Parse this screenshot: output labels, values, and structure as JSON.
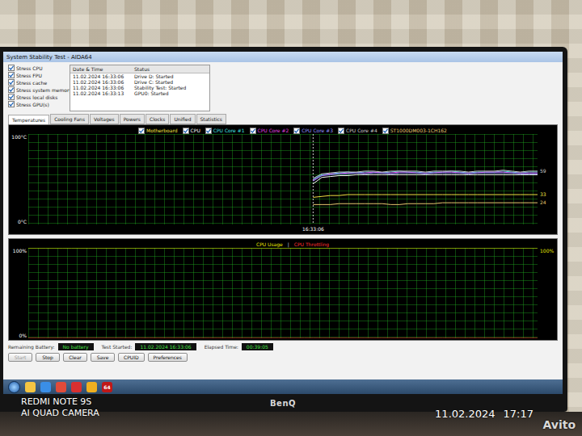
{
  "photo": {
    "camera_model": "REDMI NOTE 9S",
    "camera_label": "AI QUAD CAMERA",
    "date": "11.02.2024",
    "time": "17:17",
    "watermark": "Avito"
  },
  "monitor": {
    "brand": "BenQ"
  },
  "window": {
    "title": "System Stability Test - AIDA64"
  },
  "stress_options": [
    {
      "label": "Stress CPU",
      "checked": true
    },
    {
      "label": "Stress FPU",
      "checked": true
    },
    {
      "label": "Stress cache",
      "checked": true
    },
    {
      "label": "Stress system memory",
      "checked": true
    },
    {
      "label": "Stress local disks",
      "checked": true
    },
    {
      "label": "Stress GPU(s)",
      "checked": true
    }
  ],
  "log": {
    "columns": [
      "Date & Time",
      "Status"
    ],
    "rows": [
      [
        "11.02.2024 16:33:06",
        "Drive D: Started"
      ],
      [
        "11.02.2024 16:33:06",
        "Drive C: Started"
      ],
      [
        "11.02.2024 16:33:06",
        "Stability Test: Started"
      ],
      [
        "11.02.2024 16:33:13",
        "GPU0: Started"
      ]
    ]
  },
  "tabs": [
    {
      "label": "Temperatures",
      "selected": true
    },
    {
      "label": "Cooling Fans",
      "selected": false
    },
    {
      "label": "Voltages",
      "selected": false
    },
    {
      "label": "Powers",
      "selected": false
    },
    {
      "label": "Clocks",
      "selected": false
    },
    {
      "label": "Unified",
      "selected": false
    },
    {
      "label": "Statistics",
      "selected": false
    }
  ],
  "temperature_chart": {
    "axis_top": "100°C",
    "axis_bottom": "0°C",
    "time_mark": "16:33:06",
    "series": [
      {
        "label": "Motherboard",
        "checked": true,
        "color": "#f0e040",
        "reading": "33",
        "values": [
          30,
          31,
          32,
          32,
          33,
          33,
          33,
          33,
          33,
          33,
          33,
          33,
          33,
          33,
          33,
          33,
          33,
          33,
          33,
          33,
          33,
          33,
          33,
          33,
          33,
          33,
          33
        ]
      },
      {
        "label": "CPU",
        "checked": true,
        "color": "#ffffff",
        "values": [
          45,
          52,
          53,
          54,
          54,
          55,
          55,
          55,
          55,
          55,
          55,
          55,
          55,
          55,
          55,
          55,
          55,
          55,
          55,
          55,
          55,
          55,
          55,
          55,
          55,
          55,
          55
        ]
      },
      {
        "label": "CPU Core #1",
        "checked": true,
        "color": "#40e0e0",
        "values": [
          50,
          55,
          56,
          57,
          58,
          57,
          58,
          58,
          57,
          58,
          59,
          58,
          58,
          57,
          58,
          58,
          59,
          58,
          57,
          58,
          58,
          58,
          59,
          58,
          57,
          58,
          58
        ]
      },
      {
        "label": "CPU Core #2",
        "checked": true,
        "color": "#e040e0",
        "values": [
          49,
          54,
          56,
          56,
          57,
          57,
          57,
          58,
          57,
          57,
          58,
          58,
          57,
          57,
          57,
          58,
          58,
          57,
          57,
          57,
          58,
          58,
          58,
          57,
          57,
          57,
          57
        ]
      },
      {
        "label": "CPU Core #3",
        "checked": true,
        "color": "#9090ff",
        "values": [
          48,
          54,
          55,
          56,
          56,
          57,
          56,
          57,
          57,
          56,
          57,
          57,
          57,
          56,
          57,
          57,
          57,
          57,
          56,
          57,
          57,
          57,
          57,
          57,
          56,
          56,
          56
        ]
      },
      {
        "label": "CPU Core #4",
        "checked": true,
        "color": "#c8c8c8",
        "reading": "59",
        "values": [
          51,
          56,
          57,
          58,
          58,
          58,
          59,
          59,
          58,
          59,
          59,
          59,
          59,
          58,
          59,
          59,
          59,
          59,
          58,
          59,
          59,
          59,
          60,
          59,
          58,
          59,
          59
        ]
      },
      {
        "label": "ST1000DM003-1CH162",
        "checked": true,
        "color": "#e8c870",
        "reading": "24",
        "values": [
          22,
          22,
          22,
          23,
          23,
          23,
          23,
          23,
          23,
          22,
          22,
          23,
          23,
          23,
          23,
          24,
          24,
          24,
          24,
          24,
          24,
          24,
          24,
          24,
          24,
          24,
          24
        ]
      }
    ]
  },
  "cpu_chart": {
    "axis_top": "100%",
    "axis_bottom": "0%",
    "series": [
      {
        "label": "CPU Usage",
        "color": "#e6e600",
        "reading": "100%",
        "values": [
          100,
          100,
          100,
          100,
          100,
          100,
          100,
          100,
          100,
          100,
          100,
          100,
          100,
          100,
          100,
          100,
          100,
          100,
          100,
          100,
          100,
          100,
          100,
          100,
          100,
          100,
          100,
          100,
          100,
          100,
          100,
          100,
          100,
          100,
          100,
          100,
          100,
          100,
          100,
          100,
          100,
          100,
          100,
          100,
          100,
          100,
          100,
          100,
          100,
          100,
          100,
          100,
          100,
          100,
          100,
          100,
          100,
          100,
          100,
          100
        ]
      },
      {
        "label": "CPU Throttling",
        "color": "#ff3030",
        "values": [
          0,
          0,
          0,
          0,
          0,
          0,
          0,
          0,
          0,
          0,
          0,
          0,
          0,
          0,
          0,
          0,
          0,
          0,
          0,
          0,
          0,
          0,
          0,
          0,
          0,
          0,
          0,
          0,
          0,
          0,
          0,
          0,
          0,
          0,
          0,
          0,
          0,
          0,
          0,
          0,
          0,
          0,
          0,
          0,
          0,
          0,
          0,
          0,
          0,
          0,
          0,
          0,
          0,
          0,
          0,
          0,
          0,
          0,
          0,
          0
        ]
      }
    ],
    "separator": "|"
  },
  "status": [
    {
      "label": "Remaining Battery:",
      "value": "No battery"
    },
    {
      "label": "Test Started:",
      "value": "11.02.2024 16:33:06"
    },
    {
      "label": "Elapsed Time:",
      "value": "00:39:05"
    }
  ],
  "buttons": [
    {
      "label": "Start",
      "disabled": true
    },
    {
      "label": "Stop",
      "disabled": false
    },
    {
      "label": "Clear",
      "disabled": false
    },
    {
      "label": "Save",
      "disabled": false
    },
    {
      "label": "CPUID",
      "disabled": false
    },
    {
      "label": "Preferences",
      "disabled": false
    }
  ],
  "taskbar": {
    "apps": [
      {
        "label": "",
        "color": "#f5c542"
      },
      {
        "label": "",
        "color": "#3a8ee6"
      },
      {
        "label": "",
        "color": "#e04b3a"
      },
      {
        "label": "",
        "color": "#d83030"
      },
      {
        "label": "",
        "color": "#f0b020"
      },
      {
        "label": "64",
        "color": "#c01818"
      }
    ]
  }
}
